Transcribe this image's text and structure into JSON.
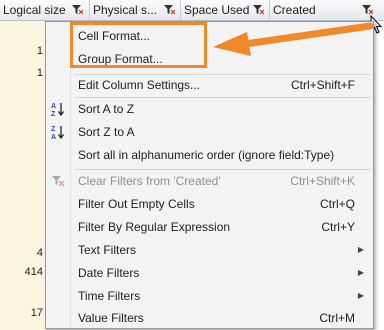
{
  "header": {
    "columns": [
      {
        "label": "Logical size"
      },
      {
        "label": "Physical s..."
      },
      {
        "label": "Space Used"
      },
      {
        "label": "Created"
      }
    ]
  },
  "data_column": {
    "cells": [
      "1",
      "1",
      "4",
      "414",
      "17"
    ]
  },
  "menu": {
    "items": [
      {
        "label": "Cell Format...",
        "shortcut": ""
      },
      {
        "label": "Group Format...",
        "shortcut": ""
      },
      {
        "label": "Edit Column Settings...",
        "shortcut": "Ctrl+Shift+F"
      },
      {
        "label": "Sort A to Z",
        "shortcut": ""
      },
      {
        "label": "Sort Z to A",
        "shortcut": ""
      },
      {
        "label": "Sort all in alphanumeric order (ignore field:Type)",
        "shortcut": ""
      },
      {
        "label": "Clear Filters from 'Created'",
        "shortcut": "Ctrl+Shift+K"
      },
      {
        "label": "Filter Out Empty Cells",
        "shortcut": "Ctrl+Q"
      },
      {
        "label": "Filter By Regular Expression",
        "shortcut": "Ctrl+Y"
      },
      {
        "label": "Text Filters",
        "shortcut": ""
      },
      {
        "label": "Date Filters",
        "shortcut": ""
      },
      {
        "label": "Time Filters",
        "shortcut": ""
      },
      {
        "label": "Value Filters",
        "shortcut": "Ctrl+M"
      }
    ]
  },
  "icons": {
    "filter": "funnel-filter-icon",
    "sort_az": "sort-a-to-z-icon",
    "sort_za": "sort-z-to-a-icon",
    "clear_filter": "clear-filter-icon",
    "submenu": "submenu-arrow-icon",
    "callout": "callout-arrow"
  },
  "colors": {
    "highlight": "#f0892a",
    "data_column_bg": "#fbf4df"
  }
}
